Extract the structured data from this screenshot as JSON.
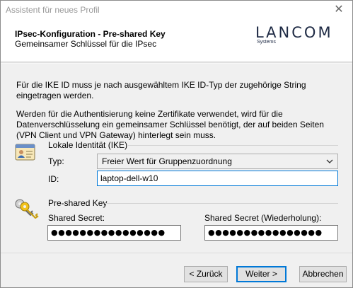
{
  "window": {
    "title": "Assistent für neues Profil",
    "close_glyph": "✕"
  },
  "header": {
    "title": "IPsec-Konfiguration - Pre-shared Key",
    "subtitle": "Gemeinsamer Schlüssel für die IPsec",
    "logo_text": "LANCOM",
    "logo_subtext": "Systems"
  },
  "body": {
    "paragraph1": "Für die IKE ID muss je nach ausgewähltem IKE ID-Typ der zugehörige String eingetragen werden.",
    "paragraph2": "Werden für die Authentisierung keine Zertifikate verwendet, wird für die Datenverschlüsselung ein gemeinsamer Schlüssel benötigt, der auf beiden Seiten (VPN Client und VPN Gateway) hinterlegt sein muss."
  },
  "identity": {
    "group_label": "Lokale Identität (IKE)",
    "icon": "id-card-icon",
    "type_label": "Typ:",
    "type_value": "Freier Wert für Gruppenzuordnung",
    "id_label": "ID:",
    "id_value": "laptop-dell-w10"
  },
  "psk": {
    "group_label": "Pre-shared Key",
    "icon": "keys-icon",
    "secret_label": "Shared Secret:",
    "secret_value": "●●●●●●●●●●●●●●●●",
    "secret_repeat_label": "Shared Secret (Wiederholung):",
    "secret_repeat_value": "●●●●●●●●●●●●●●●●"
  },
  "footer": {
    "back_label": "< Zurück",
    "next_label": "Weiter >",
    "cancel_label": "Abbrechen"
  },
  "colors": {
    "focus_border": "#0078d7",
    "logo": "#1e2a44",
    "title_text": "#999999"
  }
}
